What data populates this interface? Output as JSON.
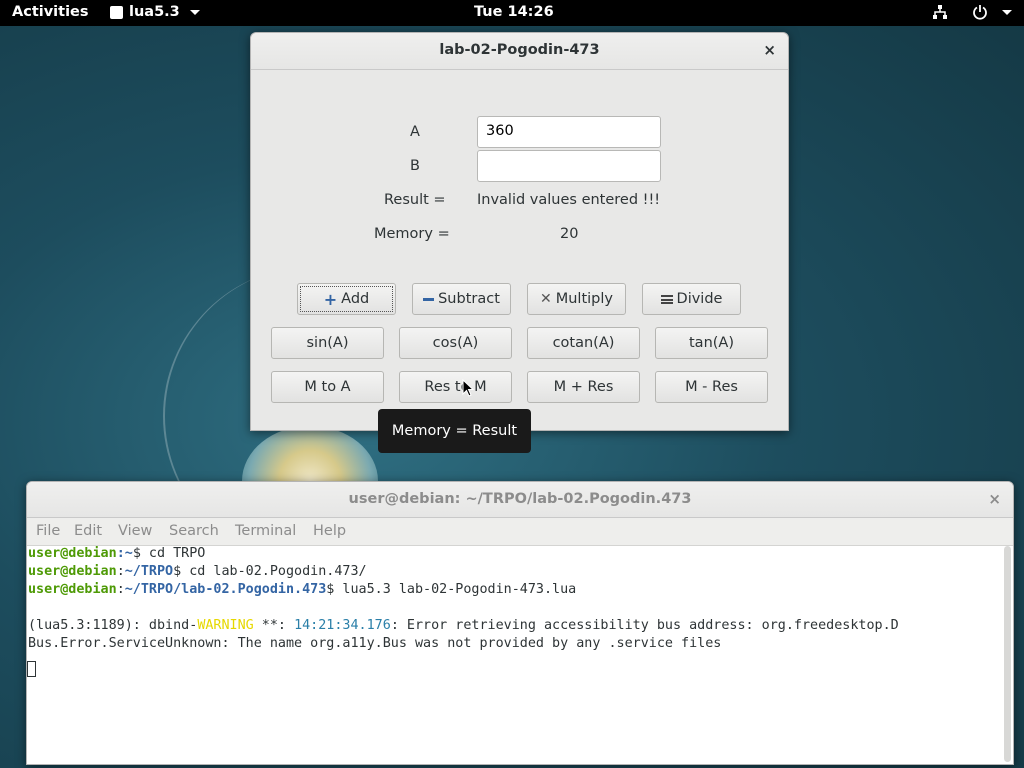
{
  "topbar": {
    "activities": "Activities",
    "app_name": "lua5.3",
    "clock": "Tue 14:26",
    "icons": [
      "network-icon",
      "power-icon"
    ]
  },
  "calc": {
    "title": "lab-02-Pogodin-473",
    "label_a": "A",
    "value_a": "360",
    "label_b": "B",
    "value_b": "",
    "result_label": "Result =",
    "result_value": "Invalid values entered !!!",
    "memory_label": "Memory =",
    "memory_value": "20",
    "buttons": {
      "add": "Add",
      "subtract": "Subtract",
      "multiply": "Multiply",
      "divide": "Divide",
      "sin": "sin(A)",
      "cos": "cos(A)",
      "cotan": "cotan(A)",
      "tan": "tan(A)",
      "m_to_a": "M to A",
      "res_to_m": "Res to M",
      "m_plus_res": "M + Res",
      "m_minus_res": "M - Res"
    },
    "tooltip": "Memory = Result",
    "close": "×"
  },
  "terminal": {
    "title": "user@debian: ~/TRPO/lab-02.Pogodin.473",
    "close": "×",
    "menu": [
      "File",
      "Edit",
      "View",
      "Search",
      "Terminal",
      "Help"
    ],
    "lines": {
      "l1_user": "user@debian",
      "l1_path": ":~",
      "l1_cmd": "$ cd TRPO",
      "l2_user": "user@debian",
      "l2_sep": ":",
      "l2_path": "~/TRPO",
      "l2_cmd": "$ cd lab-02.Pogodin.473/",
      "l3_user": "user@debian",
      "l3_sep": ":",
      "l3_path": "~/TRPO/lab-02.Pogodin.473",
      "l3_cmd": "$ lua5.3 lab-02-Pogodin-473.lua",
      "l5_a": "(lua5.3:1189): dbind-",
      "l5_warn": "WARNING",
      "l5_b": " **: ",
      "l5_time": "14:21:34.176",
      "l5_c": ": Error retrieving accessibility bus address: org.freedesktop.D",
      "l6": "Bus.Error.ServiceUnknown: The name org.a11y.Bus was not provided by any .service files"
    }
  }
}
